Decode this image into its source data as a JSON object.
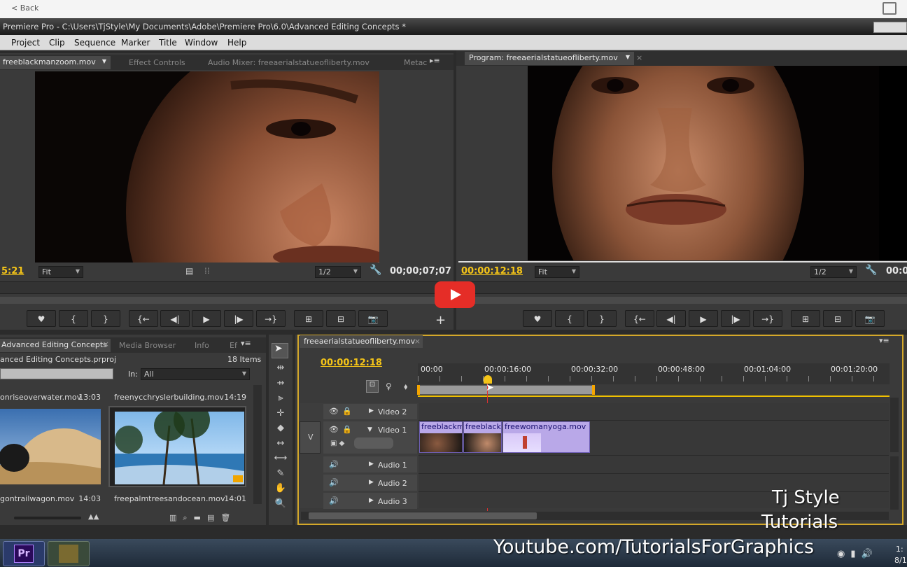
{
  "browser": {
    "back_label": "< Back"
  },
  "window": {
    "title": "Premiere Pro - C:\\Users\\TjStyle\\My Documents\\Adobe\\Premiere Pro\\6.0\\Advanced Editing Concepts *"
  },
  "menu": [
    "Project",
    "Clip",
    "Sequence",
    "Marker",
    "Title",
    "Window",
    "Help"
  ],
  "source_monitor": {
    "tabs": [
      "freeblackmanzoom.mov",
      "Effect Controls",
      "Audio Mixer: freeaerialstatueofliberty.mov",
      "Metac"
    ],
    "timecode_left": "5:21",
    "fit_label": "Fit",
    "res_label": "1/2",
    "duration": "00;00;07;07"
  },
  "program_monitor": {
    "tab": "Program: freeaerialstatueofliberty.mov",
    "timecode": "00:00:12:18",
    "fit_label": "Fit",
    "res_label": "1/2",
    "duration_partial": "00:0"
  },
  "project_panel": {
    "tabs": [
      "Advanced Editing Concepts",
      "Media Browser",
      "Info",
      "Ef"
    ],
    "project_file": "anced Editing Concepts.prproj",
    "item_count": "18 Items",
    "in_label": "In:",
    "in_value": "All",
    "clips": [
      {
        "name": "onriseoverwater.mov",
        "duration": "13:03"
      },
      {
        "name": "freenycchryslerbuilding.mov",
        "duration": "14:19"
      },
      {
        "name": "gontrailwagon.mov",
        "duration": "14:03"
      },
      {
        "name": "freepalmtreesandocean.mov",
        "duration": "14:01"
      }
    ]
  },
  "timeline": {
    "tab": "freeaerialstatueofliberty.mov",
    "timecode": "00:00:12:18",
    "ruler": [
      "00:00",
      "00:00:16:00",
      "00:00:32:00",
      "00:00:48:00",
      "00:01:04:00",
      "00:01:20:00"
    ],
    "video_tracks": [
      "Video 2",
      "Video 1"
    ],
    "audio_tracks": [
      "Audio 1",
      "Audio 2",
      "Audio 3"
    ],
    "v_label": "V",
    "clips": [
      "freeblackm",
      "freeblack",
      "freewomanyoga.mov"
    ]
  },
  "watermark": {
    "line1": "Tj Style",
    "line2": "Tutorials",
    "url": "Youtube.com/TutorialsForGraphics"
  },
  "taskbar": {
    "premiere_label": "Pr",
    "clock_partial": "1:",
    "date_partial": "8/1"
  },
  "colors": {
    "timecode": "#f5c518",
    "youtube_red": "#e52d27",
    "clip": "#b9a8e8",
    "playhead": "#e03030"
  }
}
